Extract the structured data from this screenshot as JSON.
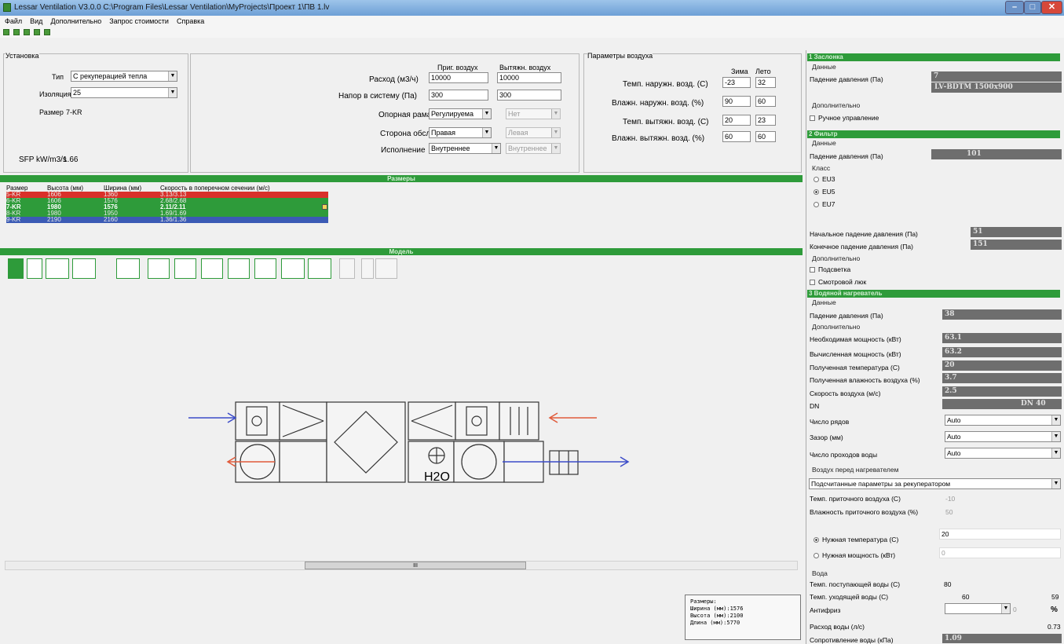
{
  "window": {
    "title": "Lessar Ventilation V3.0.0 C:\\Program Files\\Lessar Ventilation\\MyProjects\\Проект 1\\ПВ 1.lv"
  },
  "menu": [
    "Файл",
    "Вид",
    "Дополнительно",
    "Запрос стоимости",
    "Справка"
  ],
  "install": {
    "legend": "Установка",
    "type_label": "Тип",
    "type_value": "С рекуперацией тепла",
    "insulation_label": "Изоляция",
    "insulation_value": "25",
    "size_label": "Размер",
    "size_value": "7-KR",
    "sfp_label": "SFP kW/m3/s",
    "sfp_value": "1.66"
  },
  "flow": {
    "col_supply": "Приг. воздух",
    "col_exhaust": "Вытяжн. воздух",
    "rows": [
      {
        "label": "Расход (м3/ч)",
        "supply": "10000",
        "exhaust": "10000"
      },
      {
        "label": "Напор в систему (Па)",
        "supply": "300",
        "exhaust": "300"
      },
      {
        "label": "Опорная рама",
        "supply": "Регулируема",
        "exhaust": "Нет"
      },
      {
        "label": "Сторона обсл.",
        "supply": "Правая",
        "exhaust": "Левая"
      },
      {
        "label": "Исполнение",
        "supply": "Внутреннее",
        "exhaust": "Внутреннее"
      }
    ]
  },
  "air": {
    "legend": "Параметры воздуха",
    "col_winter": "Зима",
    "col_summer": "Лето",
    "rows": [
      {
        "label": "Темп. наружн. возд. (С)",
        "winter": "-23",
        "summer": "32"
      },
      {
        "label": "Влажн. наружн. возд. (%)",
        "winter": "90",
        "summer": "60"
      },
      {
        "label": "Темп. вытяжн. возд. (С)",
        "winter": "20",
        "summer": "23"
      },
      {
        "label": "Влажн. вытяжн. возд. (%)",
        "winter": "60",
        "summer": "60"
      }
    ]
  },
  "sizes": {
    "bar": "Размеры",
    "headers": [
      "Размер",
      "Высота (мм)",
      "Ширина (мм)",
      "Скорость в поперечном сечении (м/с)"
    ],
    "rows": [
      {
        "c": [
          "5-KR",
          "1606",
          "1360",
          "3.13/3.13"
        ],
        "color": "#d9302a"
      },
      {
        "c": [
          "6-KR",
          "1606",
          "1576",
          "2.68/2.68"
        ],
        "color": "#2e9b3a"
      },
      {
        "c": [
          "7-KR",
          "1980",
          "1576",
          "2.11/2.11"
        ],
        "color": "#2e9b3a"
      },
      {
        "c": [
          "8-KR",
          "1980",
          "1950",
          "1.69/1.69"
        ],
        "color": "#2e9b3a"
      },
      {
        "c": [
          "9-KR",
          "2190",
          "2160",
          "1.36/1.36"
        ],
        "color": "#3b5bb5"
      }
    ]
  },
  "model": {
    "bar": "Модель",
    "h2o": "H2O"
  },
  "dims": {
    "title": "Размеры:",
    "width": "Ширина (мм):1576",
    "height": "Высота (мм):2100",
    "length": "Длина (мм):5770"
  },
  "right": {
    "s1": "1 Заслонка",
    "data": "Данные",
    "pd_label": "Падение давления (Па)",
    "s1_pd": "7",
    "s1_model": "LV-BDTM 1500x900",
    "extra": "Дополнительно",
    "manual": "Ручное управление",
    "s2": "2 Фильтр",
    "s2_pd": "101",
    "class": "Класс",
    "eu3": "EU3",
    "eu5": "EU5",
    "eu7": "EU7",
    "init_pd_label": "Начальное падение давления (Па)",
    "init_pd": "51",
    "final_pd_label": "Конечное падение давления (Па)",
    "final_pd": "151",
    "light": "Подсветка",
    "hatch": "Смотровой люк",
    "s3": "3 Водяной нагреватель",
    "s3_pd": "38",
    "req_power_label": "Необходимая мощность (кВт)",
    "req_power": "63.1",
    "calc_power_label": "Вычисленная мощность (кВт)",
    "calc_power": "63.2",
    "temp_label": "Полученная температура (С)",
    "temp": "20",
    "hum_label": "Полученная влажность воздуха (%)",
    "hum": "3.7",
    "speed_label": "Скорость воздуха (м/с)",
    "speed": "2.5",
    "dn_label": "DN",
    "dn": "DN 40",
    "rows_label": "Число рядов",
    "rows_val": "Auto",
    "gap_label": "Зазор (мм)",
    "gap_val": "Auto",
    "passes_label": "Число проходов воды",
    "passes_val": "Auto",
    "air_before": "Воздух перед нагревателем",
    "air_before_val": "Подсчитанные параметры за рекуператором",
    "sup_temp_label": "Темп. приточного воздуха (С)",
    "sup_temp": "-10",
    "sup_hum_label": "Влажность приточного воздуха (%)",
    "sup_hum": "50",
    "need_temp": "Нужная температура (С)",
    "need_temp_val": "20",
    "need_power": "Нужная мощность (кВт)",
    "need_power_val": "0",
    "water": "Вода",
    "win_label": "Темп. поступающей воды (С)",
    "win": "80",
    "wout_label": "Темп. уходящей воды (С)",
    "wout": "60",
    "wout2": "59",
    "anti_label": "Антифриз",
    "anti_pct": "0",
    "anti_unit": "%",
    "flow_label": "Расход воды (л/с)",
    "flow": "0.73",
    "res_label": "Сопротивление воды (кПа)",
    "res": "1.09"
  },
  "scroll": {
    "mid": "III"
  }
}
